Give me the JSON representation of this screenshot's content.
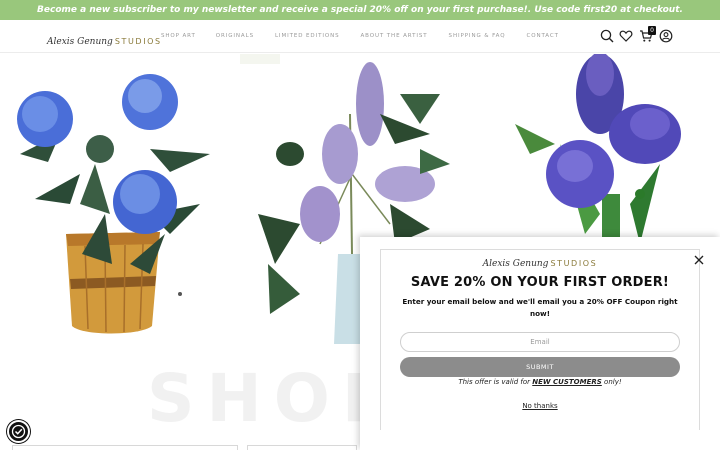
{
  "announcement": {
    "text": "Become a new subscriber to my newsletter and receive a special 20% off on your first purchase!. Use code first20 at checkout."
  },
  "header": {
    "logo_script": "Alexis Genung",
    "logo_studios": "STUDIOS",
    "nav": [
      {
        "label": "SHOP ART"
      },
      {
        "label": "ORIGINALS"
      },
      {
        "label": "LIMITED EDITIONS"
      },
      {
        "label": "ABOUT THE ARTIST"
      },
      {
        "label": "SHIPPING & FAQ"
      },
      {
        "label": "CONTACT"
      }
    ],
    "icons": [
      "search-icon",
      "heart-icon",
      "cart-icon",
      "account-icon"
    ],
    "cart_count": "0"
  },
  "hero": {
    "images": [
      "hydrangea-painting",
      "lilac-painting",
      "iris-painting"
    ]
  },
  "shop": {
    "title": "SHOP"
  },
  "popup": {
    "logo_script": "Alexis Genung",
    "logo_studios": "STUDIOS",
    "headline": "SAVE 20% ON YOUR FIRST ORDER!",
    "description": "Enter your email below and we'll email you a 20% OFF Coupon right now!",
    "email_placeholder": "Email",
    "submit_label": "SUBMIT",
    "valid_prefix": "This offer is valid for ",
    "valid_highlight": "NEW CUSTOMERS",
    "valid_suffix": " only!",
    "decline_label": "No thanks"
  },
  "colors": {
    "announcement_bg": "#99c77c",
    "submit_bg": "#8c8c8c",
    "logo_gold": "#8a7a3a"
  }
}
